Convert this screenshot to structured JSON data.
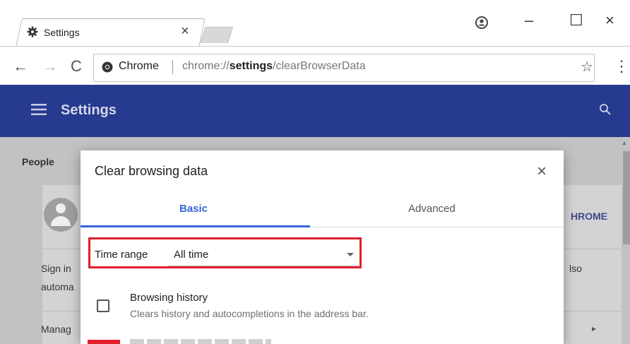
{
  "tab": {
    "title": "Settings",
    "close": "×"
  },
  "window": {
    "minimize": "–",
    "maximize": "☐",
    "close": "×"
  },
  "toolbar": {
    "back": "←",
    "forward": "→",
    "reload": "C",
    "site_name": "Chrome",
    "url_prefix": "chrome://",
    "url_bold": "settings",
    "url_suffix": "/clearBrowserData",
    "star": "☆",
    "menu": "⋮"
  },
  "header": {
    "title": "Settings"
  },
  "background": {
    "people": "People",
    "chrome_btn": "HROME",
    "sign_in_1": "Sign in",
    "sign_in_2": "automa",
    "also": "lso",
    "manage": "Manag",
    "arrow": "▸"
  },
  "dialog": {
    "title": "Clear browsing data",
    "close": "×",
    "tabs": [
      {
        "label": "Basic",
        "selected": true
      },
      {
        "label": "Advanced",
        "selected": false
      }
    ],
    "time_range_label": "Time range",
    "time_range_value": "All time",
    "options": [
      {
        "title": "Browsing history",
        "description": "Clears history and autocompletions in the address bar.",
        "checked": false
      }
    ]
  },
  "colors": {
    "accent": "#3367d6",
    "header": "#263a8f",
    "highlight": "#e0202a"
  }
}
